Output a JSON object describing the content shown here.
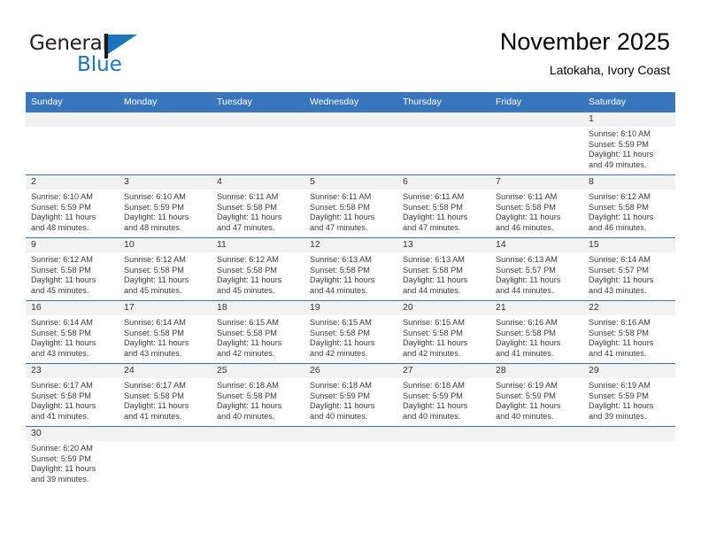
{
  "brand": {
    "name_top": "General",
    "name_bottom": "Blue",
    "accent_color": "#1b75bb"
  },
  "header": {
    "title": "November 2025",
    "subtitle": "Latokaha, Ivory Coast"
  },
  "calendar": {
    "header_color": "#3a76bd",
    "weekday_headers": [
      "Sunday",
      "Monday",
      "Tuesday",
      "Wednesday",
      "Thursday",
      "Friday",
      "Saturday"
    ],
    "labels": {
      "sunrise": "Sunrise:",
      "sunset": "Sunset:",
      "daylight": "Daylight:"
    },
    "weeks": [
      [
        {
          "empty": true
        },
        {
          "empty": true
        },
        {
          "empty": true
        },
        {
          "empty": true
        },
        {
          "empty": true
        },
        {
          "empty": true
        },
        {
          "day": "1",
          "sunrise": "Sunrise: 6:10 AM",
          "sunset": "Sunset: 5:59 PM",
          "daylight_1": "Daylight: 11 hours",
          "daylight_2": "and 49 minutes."
        }
      ],
      [
        {
          "day": "2",
          "sunrise": "Sunrise: 6:10 AM",
          "sunset": "Sunset: 5:59 PM",
          "daylight_1": "Daylight: 11 hours",
          "daylight_2": "and 48 minutes."
        },
        {
          "day": "3",
          "sunrise": "Sunrise: 6:10 AM",
          "sunset": "Sunset: 5:59 PM",
          "daylight_1": "Daylight: 11 hours",
          "daylight_2": "and 48 minutes."
        },
        {
          "day": "4",
          "sunrise": "Sunrise: 6:11 AM",
          "sunset": "Sunset: 5:58 PM",
          "daylight_1": "Daylight: 11 hours",
          "daylight_2": "and 47 minutes."
        },
        {
          "day": "5",
          "sunrise": "Sunrise: 6:11 AM",
          "sunset": "Sunset: 5:58 PM",
          "daylight_1": "Daylight: 11 hours",
          "daylight_2": "and 47 minutes."
        },
        {
          "day": "6",
          "sunrise": "Sunrise: 6:11 AM",
          "sunset": "Sunset: 5:58 PM",
          "daylight_1": "Daylight: 11 hours",
          "daylight_2": "and 47 minutes."
        },
        {
          "day": "7",
          "sunrise": "Sunrise: 6:11 AM",
          "sunset": "Sunset: 5:58 PM",
          "daylight_1": "Daylight: 11 hours",
          "daylight_2": "and 46 minutes."
        },
        {
          "day": "8",
          "sunrise": "Sunrise: 6:12 AM",
          "sunset": "Sunset: 5:58 PM",
          "daylight_1": "Daylight: 11 hours",
          "daylight_2": "and 46 minutes."
        }
      ],
      [
        {
          "day": "9",
          "sunrise": "Sunrise: 6:12 AM",
          "sunset": "Sunset: 5:58 PM",
          "daylight_1": "Daylight: 11 hours",
          "daylight_2": "and 45 minutes."
        },
        {
          "day": "10",
          "sunrise": "Sunrise: 6:12 AM",
          "sunset": "Sunset: 5:58 PM",
          "daylight_1": "Daylight: 11 hours",
          "daylight_2": "and 45 minutes."
        },
        {
          "day": "11",
          "sunrise": "Sunrise: 6:12 AM",
          "sunset": "Sunset: 5:58 PM",
          "daylight_1": "Daylight: 11 hours",
          "daylight_2": "and 45 minutes."
        },
        {
          "day": "12",
          "sunrise": "Sunrise: 6:13 AM",
          "sunset": "Sunset: 5:58 PM",
          "daylight_1": "Daylight: 11 hours",
          "daylight_2": "and 44 minutes."
        },
        {
          "day": "13",
          "sunrise": "Sunrise: 6:13 AM",
          "sunset": "Sunset: 5:58 PM",
          "daylight_1": "Daylight: 11 hours",
          "daylight_2": "and 44 minutes."
        },
        {
          "day": "14",
          "sunrise": "Sunrise: 6:13 AM",
          "sunset": "Sunset: 5:57 PM",
          "daylight_1": "Daylight: 11 hours",
          "daylight_2": "and 44 minutes."
        },
        {
          "day": "15",
          "sunrise": "Sunrise: 6:14 AM",
          "sunset": "Sunset: 5:57 PM",
          "daylight_1": "Daylight: 11 hours",
          "daylight_2": "and 43 minutes."
        }
      ],
      [
        {
          "day": "16",
          "sunrise": "Sunrise: 6:14 AM",
          "sunset": "Sunset: 5:58 PM",
          "daylight_1": "Daylight: 11 hours",
          "daylight_2": "and 43 minutes."
        },
        {
          "day": "17",
          "sunrise": "Sunrise: 6:14 AM",
          "sunset": "Sunset: 5:58 PM",
          "daylight_1": "Daylight: 11 hours",
          "daylight_2": "and 43 minutes."
        },
        {
          "day": "18",
          "sunrise": "Sunrise: 6:15 AM",
          "sunset": "Sunset: 5:58 PM",
          "daylight_1": "Daylight: 11 hours",
          "daylight_2": "and 42 minutes."
        },
        {
          "day": "19",
          "sunrise": "Sunrise: 6:15 AM",
          "sunset": "Sunset: 5:58 PM",
          "daylight_1": "Daylight: 11 hours",
          "daylight_2": "and 42 minutes."
        },
        {
          "day": "20",
          "sunrise": "Sunrise: 6:15 AM",
          "sunset": "Sunset: 5:58 PM",
          "daylight_1": "Daylight: 11 hours",
          "daylight_2": "and 42 minutes."
        },
        {
          "day": "21",
          "sunrise": "Sunrise: 6:16 AM",
          "sunset": "Sunset: 5:58 PM",
          "daylight_1": "Daylight: 11 hours",
          "daylight_2": "and 41 minutes."
        },
        {
          "day": "22",
          "sunrise": "Sunrise: 6:16 AM",
          "sunset": "Sunset: 5:58 PM",
          "daylight_1": "Daylight: 11 hours",
          "daylight_2": "and 41 minutes."
        }
      ],
      [
        {
          "day": "23",
          "sunrise": "Sunrise: 6:17 AM",
          "sunset": "Sunset: 5:58 PM",
          "daylight_1": "Daylight: 11 hours",
          "daylight_2": "and 41 minutes."
        },
        {
          "day": "24",
          "sunrise": "Sunrise: 6:17 AM",
          "sunset": "Sunset: 5:58 PM",
          "daylight_1": "Daylight: 11 hours",
          "daylight_2": "and 41 minutes."
        },
        {
          "day": "25",
          "sunrise": "Sunrise: 6:18 AM",
          "sunset": "Sunset: 5:58 PM",
          "daylight_1": "Daylight: 11 hours",
          "daylight_2": "and 40 minutes."
        },
        {
          "day": "26",
          "sunrise": "Sunrise: 6:18 AM",
          "sunset": "Sunset: 5:59 PM",
          "daylight_1": "Daylight: 11 hours",
          "daylight_2": "and 40 minutes."
        },
        {
          "day": "27",
          "sunrise": "Sunrise: 6:18 AM",
          "sunset": "Sunset: 5:59 PM",
          "daylight_1": "Daylight: 11 hours",
          "daylight_2": "and 40 minutes."
        },
        {
          "day": "28",
          "sunrise": "Sunrise: 6:19 AM",
          "sunset": "Sunset: 5:59 PM",
          "daylight_1": "Daylight: 11 hours",
          "daylight_2": "and 40 minutes."
        },
        {
          "day": "29",
          "sunrise": "Sunrise: 6:19 AM",
          "sunset": "Sunset: 5:59 PM",
          "daylight_1": "Daylight: 11 hours",
          "daylight_2": "and 39 minutes."
        }
      ],
      [
        {
          "day": "30",
          "sunrise": "Sunrise: 6:20 AM",
          "sunset": "Sunset: 5:59 PM",
          "daylight_1": "Daylight: 11 hours",
          "daylight_2": "and 39 minutes."
        },
        {
          "empty": true
        },
        {
          "empty": true
        },
        {
          "empty": true
        },
        {
          "empty": true
        },
        {
          "empty": true
        },
        {
          "empty": true
        }
      ]
    ]
  }
}
